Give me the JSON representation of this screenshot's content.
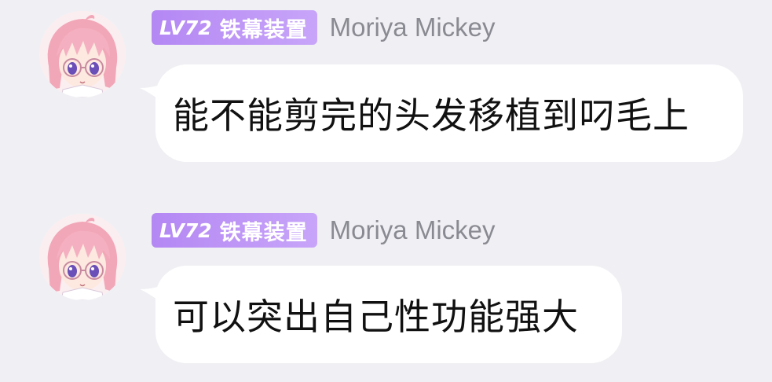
{
  "messages": [
    {
      "level": "LV72",
      "level_label": "LV",
      "level_number": "72",
      "badge_title": "铁幕装置",
      "username": "Moriya Mickey",
      "avatar_icon": "anime-girl-pink-hair-glasses-avatar",
      "text": "能不能剪完的头发移植到叼毛上"
    },
    {
      "level": "LV72",
      "level_label": "LV",
      "level_number": "72",
      "badge_title": "铁幕装置",
      "username": "Moriya Mickey",
      "avatar_icon": "anime-girl-pink-hair-glasses-avatar",
      "text": "可以突出自己性功能强大"
    }
  ],
  "colors": {
    "background": "#f0f0f4",
    "bubble": "#ffffff",
    "badge_start": "#b487f3",
    "badge_end": "#c8a5f9",
    "username": "#8a8a92",
    "text": "#111111"
  }
}
